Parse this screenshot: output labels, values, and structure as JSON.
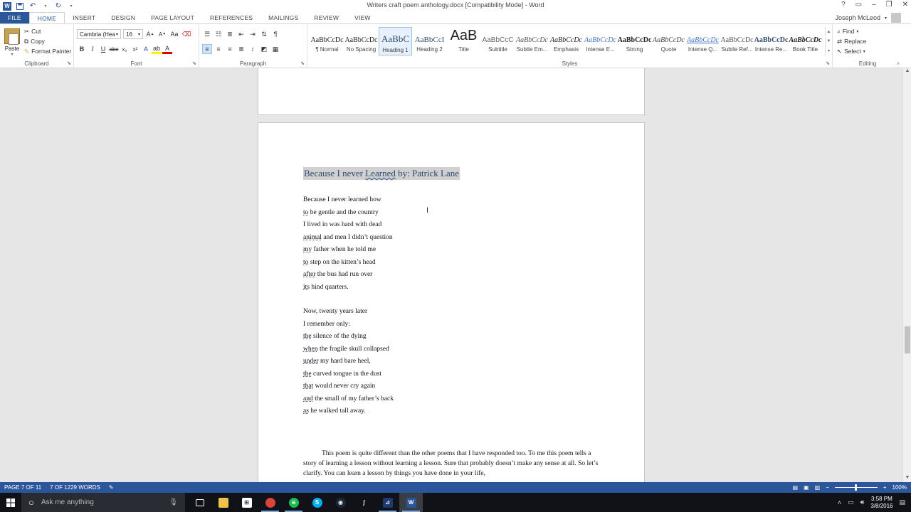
{
  "window": {
    "title": "Writers craft poem anthology.docx [Compatibility Mode] - Word",
    "user": "Joseph McLeod",
    "help_glyph": "?",
    "min_glyph": "–",
    "max_glyph": "❐",
    "close_glyph": "✕"
  },
  "tabs": [
    "FILE",
    "HOME",
    "INSERT",
    "DESIGN",
    "PAGE LAYOUT",
    "REFERENCES",
    "MAILINGS",
    "REVIEW",
    "VIEW"
  ],
  "ribbon": {
    "clipboard": {
      "paste": "Paste",
      "cut": "Cut",
      "copy": "Copy",
      "format_painter": "Format Painter",
      "label": "Clipboard"
    },
    "font": {
      "name": "Cambria (Hea",
      "size": "16",
      "label": "Font",
      "bold": "B",
      "italic": "I",
      "underline": "U"
    },
    "paragraph": {
      "label": "Paragraph"
    },
    "styles": {
      "label": "Styles",
      "items": [
        {
          "preview": "AaBbCcDc",
          "name": "¶ Normal"
        },
        {
          "preview": "AaBbCcDc",
          "name": "No Spacing"
        },
        {
          "preview": "AaBbC",
          "name": "Heading 1"
        },
        {
          "preview": "AaBbCcI",
          "name": "Heading 2"
        },
        {
          "preview": "AaB",
          "name": "Title"
        },
        {
          "preview": "AaBbCcC",
          "name": "Subtitle"
        },
        {
          "preview": "AaBbCcDc",
          "name": "Subtle Em..."
        },
        {
          "preview": "AaBbCcDc",
          "name": "Emphasis"
        },
        {
          "preview": "AaBbCcDc",
          "name": "Intense E..."
        },
        {
          "preview": "AaBbCcDc",
          "name": "Strong"
        },
        {
          "preview": "AaBbCcDc",
          "name": "Quote"
        },
        {
          "preview": "AaBbCcDc",
          "name": "Intense Q..."
        },
        {
          "preview": "AaBbCcDc",
          "name": "Subtle Ref..."
        },
        {
          "preview": "AaBbCcDc",
          "name": "Intense Re..."
        },
        {
          "preview": "AaBbCcDc",
          "name": "Book Title"
        }
      ]
    },
    "editing": {
      "find": "Find",
      "replace": "Replace",
      "select": "Select",
      "label": "Editing"
    }
  },
  "document": {
    "title_pre": "Because I never ",
    "title_word": "Learned",
    "title_post": "  by: Patrick Lane",
    "stanza1": [
      {
        "first": "",
        "rest": "Because I never learned how"
      },
      {
        "first": "to",
        "rest": " be gentle and the country"
      },
      {
        "first": "",
        "rest": "I lived in was hard with dead"
      },
      {
        "first": "animal",
        "rest": " and men I didn’t question"
      },
      {
        "first": "my",
        "rest": " father when he told me"
      },
      {
        "first": "to",
        "rest": " step on the kitten’s head"
      },
      {
        "first": "after",
        "rest": " the bus had run over"
      },
      {
        "first": "its",
        "rest": " hind quarters."
      }
    ],
    "stanza2": [
      {
        "first": "",
        "rest": "Now, twenty years later"
      },
      {
        "first": "",
        "rest": "I remember only:"
      },
      {
        "first": "the",
        "rest": " silence of the dying"
      },
      {
        "first": "when",
        "rest": " the fragile skull collapsed"
      },
      {
        "first": "under",
        "rest": " my hard bare heel,"
      },
      {
        "first": "the",
        "rest": " curved tongue in the dust"
      },
      {
        "first": "that",
        "rest": " would never cry again"
      },
      {
        "first": "and",
        "rest": " the small of my father’s back"
      },
      {
        "first": "as",
        "rest": " he walked tall away."
      }
    ],
    "paragraph": "This poem is quite different than the other poems that I have responded too. To me this poem tells a story of learning a lesson without learning a lesson. Sure that probably doesn’t make any sense at all. So let’s clarify. You can learn a lesson by things you have done in your life,"
  },
  "status": {
    "page": "PAGE 7 OF 11",
    "words": "7 OF 1229 WORDS",
    "zoom": "100%",
    "zoom_level": 1.0
  },
  "taskbar": {
    "search_placeholder": "Ask me anything",
    "time": "3:58 PM",
    "date": "3/8/2016"
  }
}
